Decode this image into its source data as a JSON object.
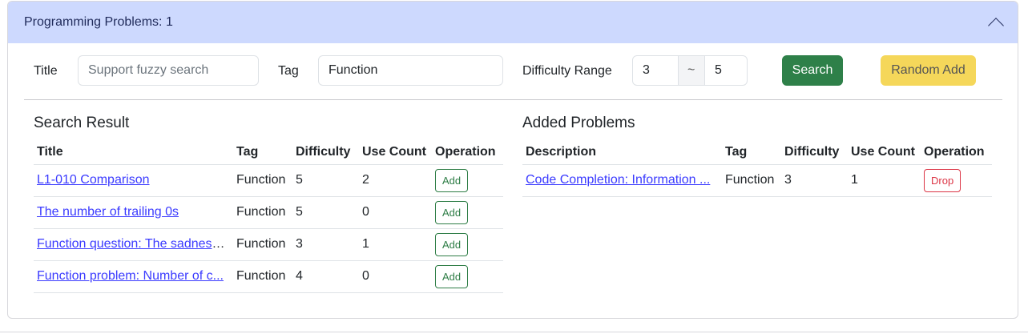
{
  "header": {
    "title": "Programming Problems: 1"
  },
  "filters": {
    "title_label": "Title",
    "title_placeholder": "Support fuzzy search",
    "tag_label": "Tag",
    "tag_value": "Function",
    "difficulty_label": "Difficulty Range",
    "difficulty_min": "3",
    "range_sep": "~",
    "difficulty_max": "5",
    "search_label": "Search",
    "random_add_label": "Random Add"
  },
  "search_result": {
    "heading": "Search Result",
    "columns": [
      "Title",
      "Tag",
      "Difficulty",
      "Use Count",
      "Operation"
    ],
    "rows": [
      {
        "title": "L1-010 Comparison",
        "tag": "Function",
        "difficulty": "5",
        "use_count": "2",
        "op": "Add"
      },
      {
        "title": "The number of trailing 0s",
        "tag": "Function",
        "difficulty": "5",
        "use_count": "0",
        "op": "Add"
      },
      {
        "title": "Function question: The sadness of ...",
        "tag": "Function",
        "difficulty": "3",
        "use_count": "1",
        "op": "Add"
      },
      {
        "title": "Function problem: Number of c...",
        "tag": "Function",
        "difficulty": "4",
        "use_count": "0",
        "op": "Add"
      }
    ]
  },
  "added": {
    "heading": "Added Problems",
    "columns": [
      "Description",
      "Tag",
      "Difficulty",
      "Use Count",
      "Operation"
    ],
    "rows": [
      {
        "title": "Code Completion: Information ...",
        "tag": "Function",
        "difficulty": "3",
        "use_count": "1",
        "op": "Drop"
      }
    ]
  },
  "colors": {
    "header_bg": "#cdd9fe",
    "search_btn": "#2e8049",
    "random_btn": "#f5d75a",
    "link": "#3b3bff"
  }
}
